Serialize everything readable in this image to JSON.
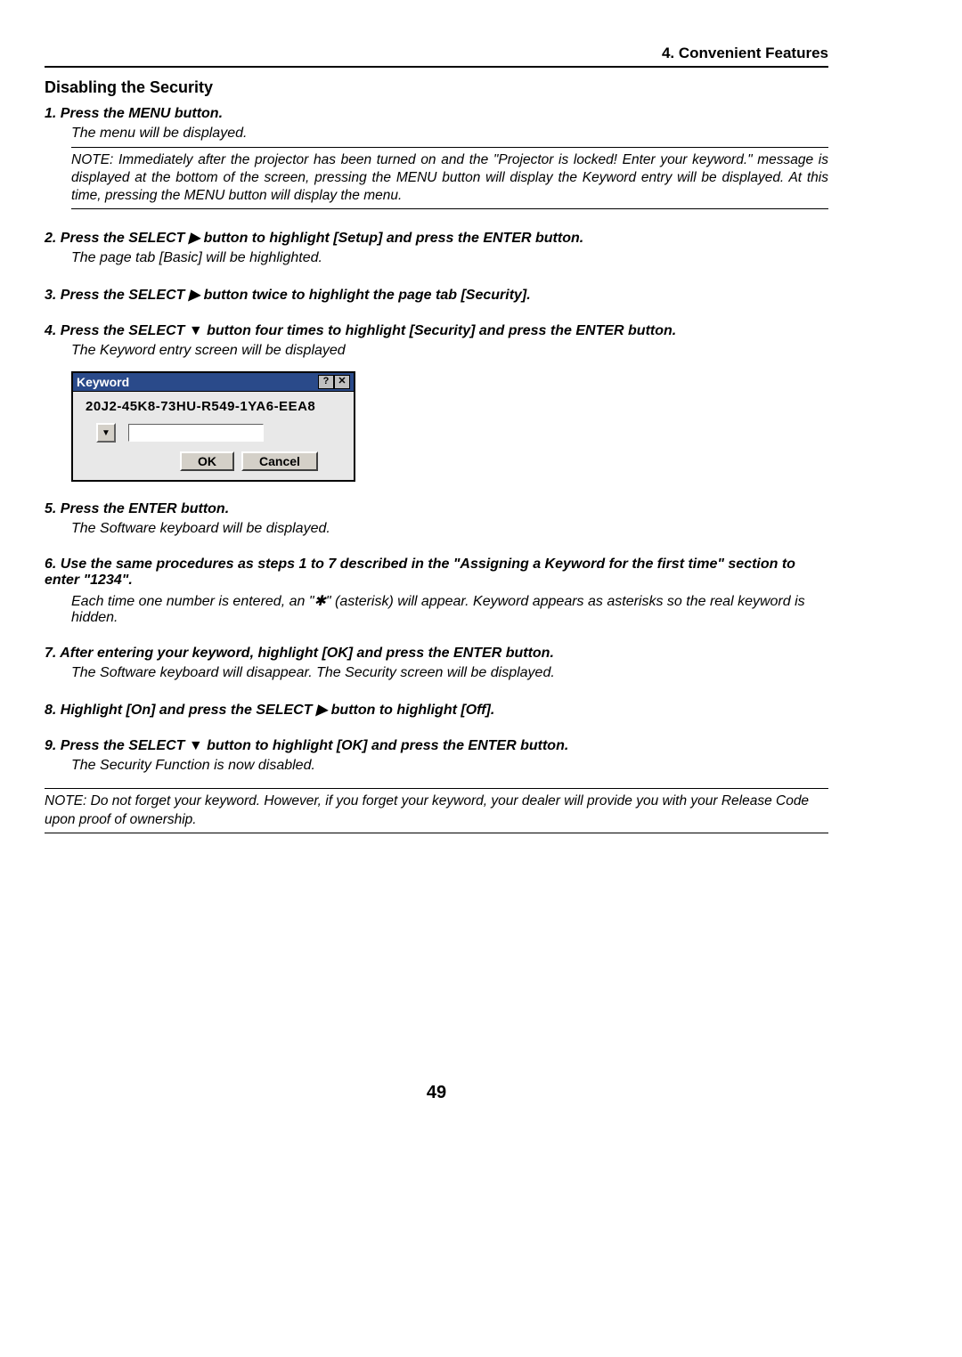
{
  "header": {
    "title": "4. Convenient Features"
  },
  "section": {
    "title": "Disabling the Security"
  },
  "steps": {
    "s1": {
      "title": "1.  Press the MENU button.",
      "desc": "The menu will be displayed.",
      "note": "NOTE: Immediately after the projector has been turned on and the \"Projector is locked! Enter your keyword.\" message is displayed at the bottom of the screen, pressing the MENU button will display the Keyword entry will be displayed. At this time, pressing the MENU button will display the menu."
    },
    "s2": {
      "title": "2.  Press the SELECT ▶ button to highlight [Setup] and press the ENTER button.",
      "desc": "The page tab [Basic] will be highlighted."
    },
    "s3": {
      "title": "3.  Press the SELECT ▶ button twice to highlight the page tab [Security]."
    },
    "s4": {
      "title": "4.  Press the SELECT ▼ button four times to highlight [Security] and press the ENTER button.",
      "desc": "The Keyword entry screen will be displayed"
    },
    "s5": {
      "title": "5.  Press the ENTER button.",
      "desc": "The Software keyboard will be displayed."
    },
    "s6": {
      "title": "6.  Use the same procedures as steps 1 to 7 described in the \"Assigning a Keyword for the first time\" section to enter \"1234\".",
      "desc": "Each time one number is entered, an \"✱\" (asterisk) will appear. Keyword appears as asterisks so the real keyword is hidden."
    },
    "s7": {
      "title": "7.  After entering your keyword, highlight [OK] and press the ENTER button.",
      "desc": "The Software keyboard will disappear. The Security screen will be displayed."
    },
    "s8": {
      "title": "8.  Highlight [On] and press the SELECT ▶ button to highlight [Off]."
    },
    "s9": {
      "title": "9.  Press the SELECT ▼ button to highlight [OK] and press the ENTER button.",
      "desc": "The Security Function is now disabled."
    }
  },
  "dialog": {
    "title": "Keyword",
    "help": "?",
    "close": "✕",
    "serial": "20J2-45K8-73HU-R549-1YA6-EEA8",
    "dropdown": "▼",
    "ok": "OK",
    "cancel": "Cancel"
  },
  "final_note": "NOTE: Do not forget your keyword. However, if you forget your keyword, your dealer will provide you with your Release Code upon proof of ownership.",
  "page_number": "49"
}
